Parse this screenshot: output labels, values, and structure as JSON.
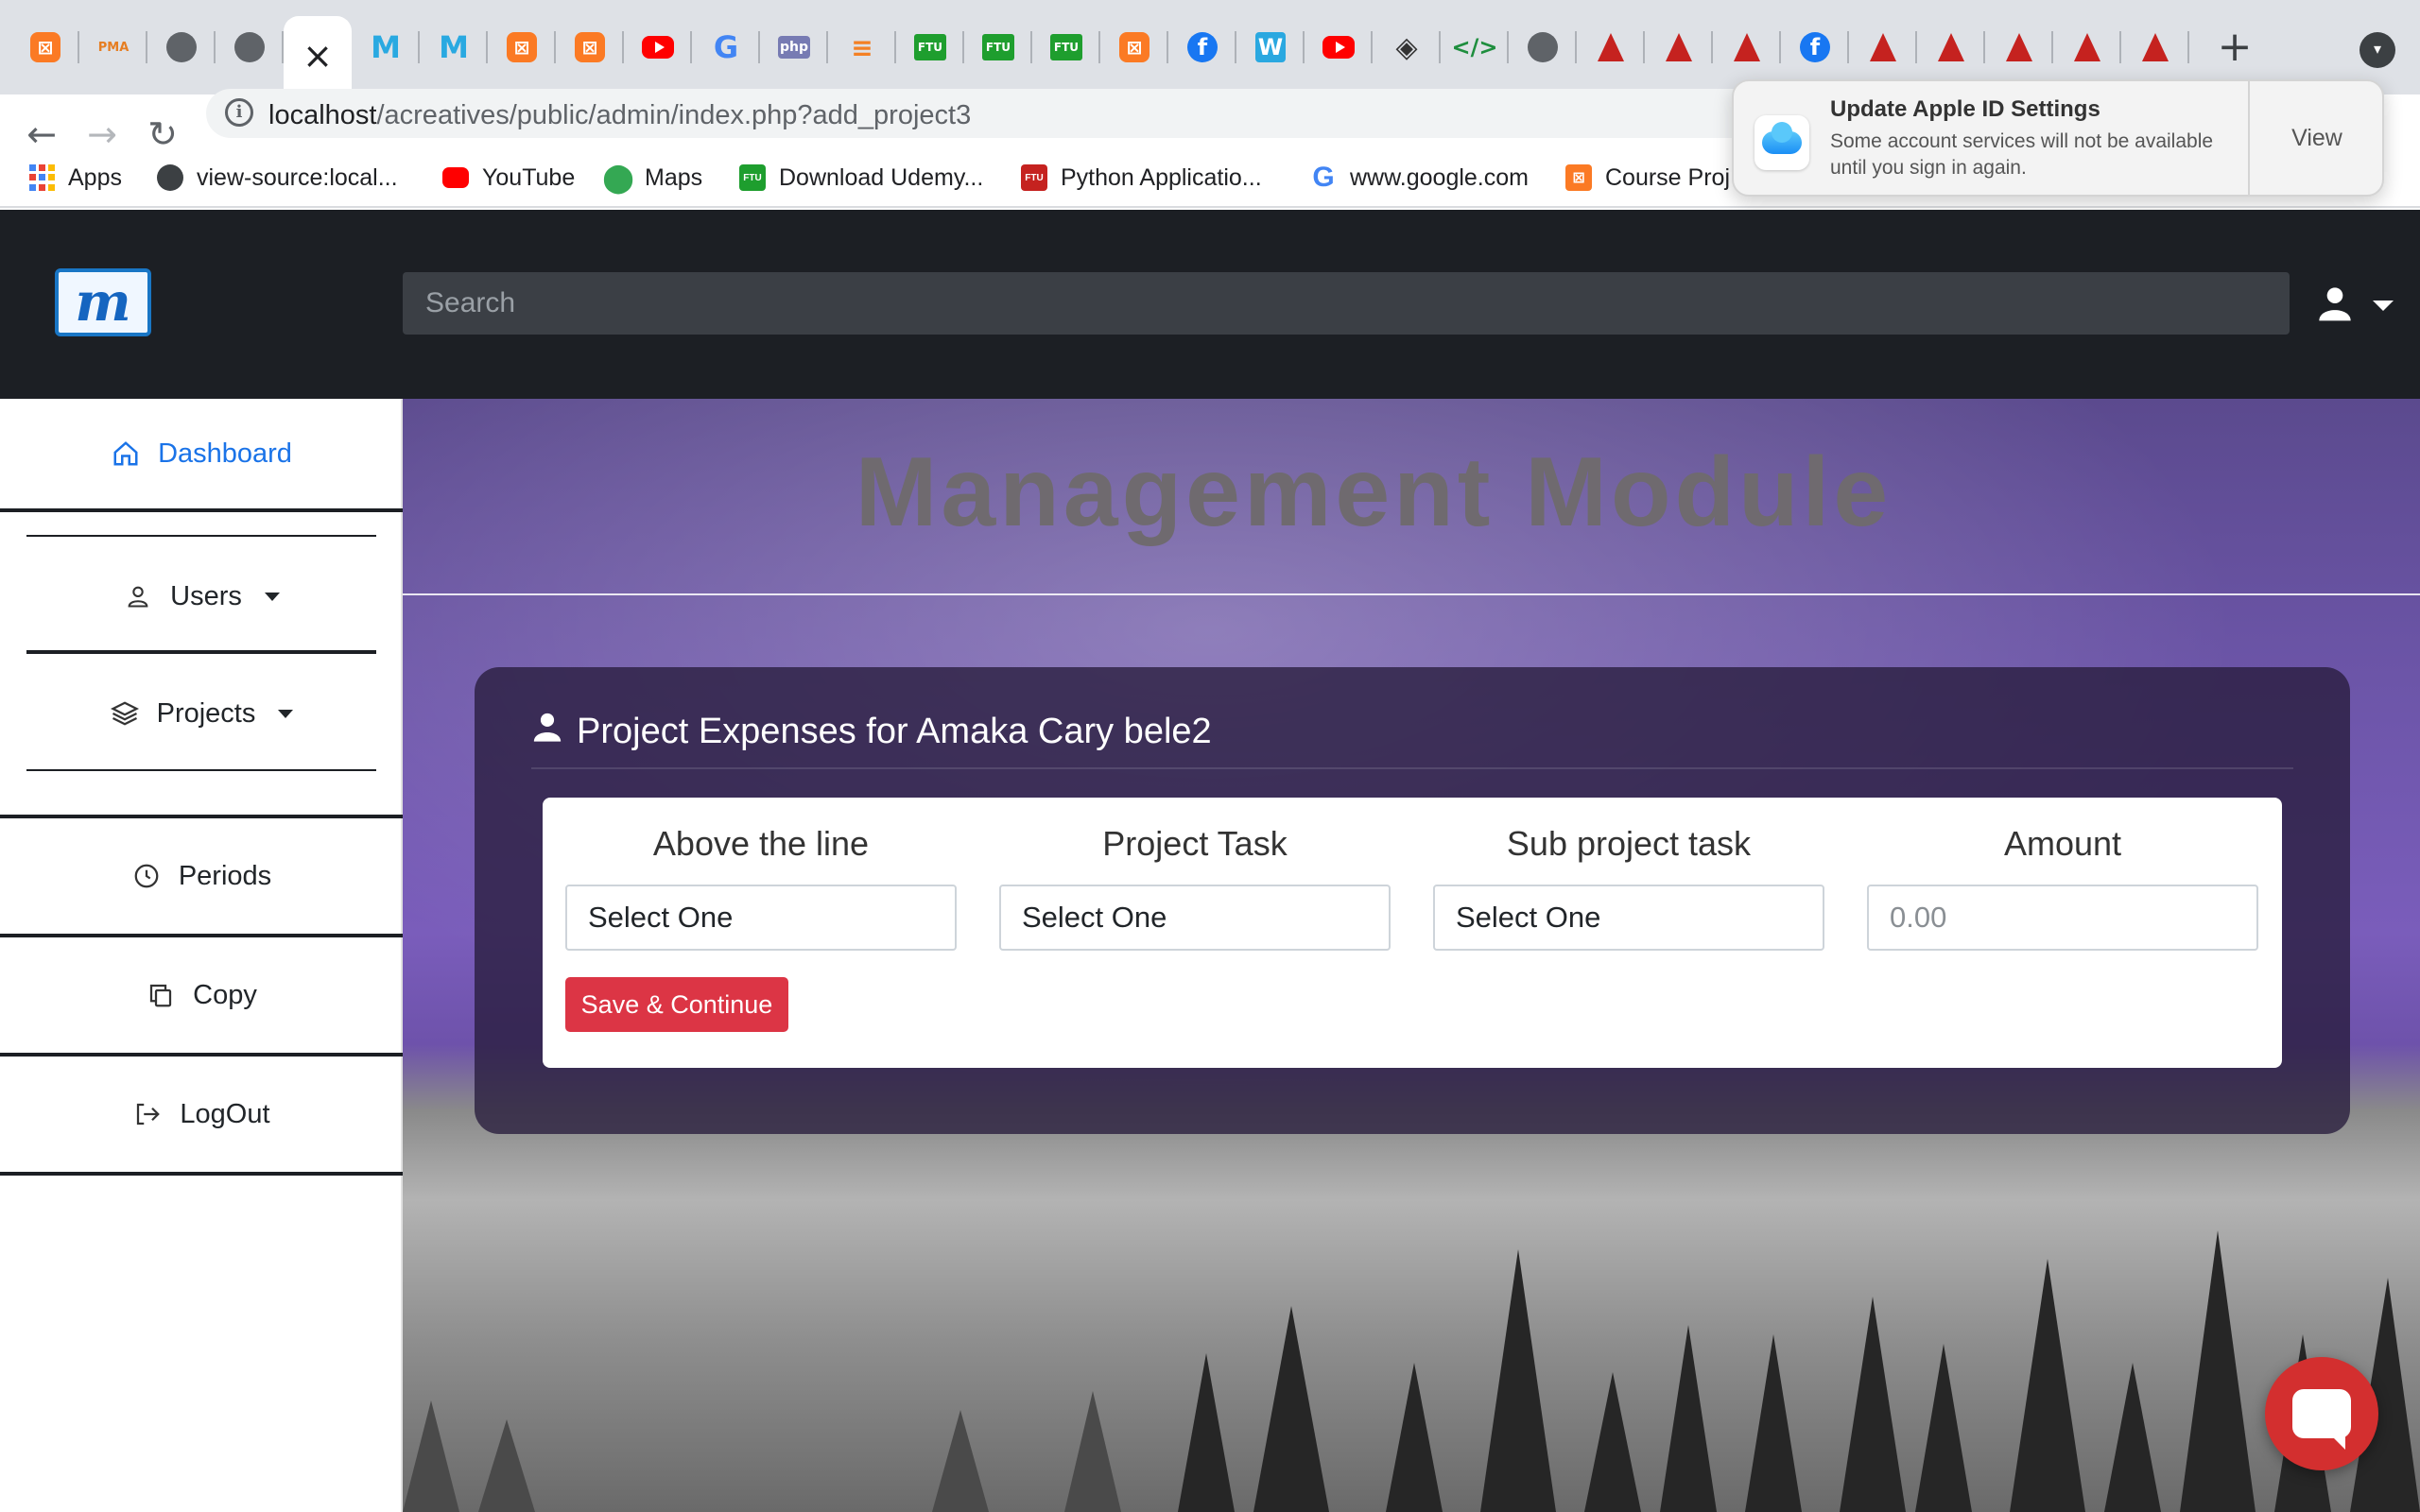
{
  "browser": {
    "tabs": [
      {
        "icon": "xampp-icon",
        "glyph": "⊠",
        "cls": "xampp"
      },
      {
        "icon": "phpmyadmin-icon",
        "glyph": "PMA",
        "cls": "pma"
      },
      {
        "icon": "globe-icon",
        "glyph": "",
        "cls": "globe"
      },
      {
        "icon": "globe-icon",
        "glyph": "",
        "cls": "globe"
      },
      {
        "icon": "close-icon",
        "glyph": "",
        "cls": "active"
      },
      {
        "icon": "m-icon",
        "glyph": "M",
        "cls": "m"
      },
      {
        "icon": "m-icon",
        "glyph": "M",
        "cls": "m"
      },
      {
        "icon": "xampp-icon",
        "glyph": "⊠",
        "cls": "xampp"
      },
      {
        "icon": "xampp-icon",
        "glyph": "⊠",
        "cls": "xampp"
      },
      {
        "icon": "youtube-icon",
        "glyph": "",
        "cls": "yt"
      },
      {
        "icon": "google-icon",
        "glyph": "G",
        "cls": "g"
      },
      {
        "icon": "php-icon",
        "glyph": "php",
        "cls": "php"
      },
      {
        "icon": "stackoverflow-icon",
        "glyph": "≡",
        "cls": "so"
      },
      {
        "icon": "ftu-icon",
        "glyph": "FTU",
        "cls": "ftu"
      },
      {
        "icon": "ftu-icon",
        "glyph": "FTU",
        "cls": "ftu"
      },
      {
        "icon": "ftu-icon",
        "glyph": "FTU",
        "cls": "ftu"
      },
      {
        "icon": "xampp-icon",
        "glyph": "⊠",
        "cls": "xampp"
      },
      {
        "icon": "facebook-icon",
        "glyph": "f",
        "cls": "fb"
      },
      {
        "icon": "w-icon",
        "glyph": "W",
        "cls": "w"
      },
      {
        "icon": "youtube-icon",
        "glyph": "",
        "cls": "yt"
      },
      {
        "icon": "diamond-icon",
        "glyph": "◈",
        "cls": "dia"
      },
      {
        "icon": "code-icon",
        "glyph": "</>",
        "cls": "code"
      },
      {
        "icon": "globe-icon",
        "glyph": "",
        "cls": "globe"
      },
      {
        "icon": "angular-icon",
        "glyph": "",
        "cls": "tri"
      },
      {
        "icon": "angular-icon",
        "glyph": "",
        "cls": "tri"
      },
      {
        "icon": "angular-icon",
        "glyph": "",
        "cls": "tri"
      },
      {
        "icon": "facebook-icon",
        "glyph": "f",
        "cls": "fb"
      },
      {
        "icon": "angular-icon",
        "glyph": "",
        "cls": "tri"
      },
      {
        "icon": "angular-icon",
        "glyph": "",
        "cls": "tri"
      },
      {
        "icon": "angular-icon",
        "glyph": "",
        "cls": "tri"
      },
      {
        "icon": "angular-icon",
        "glyph": "",
        "cls": "tri"
      },
      {
        "icon": "angular-icon",
        "glyph": "",
        "cls": "tri"
      }
    ],
    "url_host": "localhost",
    "url_path": "/acreatives/public/admin/index.php?add_project3",
    "bookmarks": [
      {
        "label": "Apps",
        "icon": "apps-grid-icon",
        "cls": "grid"
      },
      {
        "label": "view-source:local...",
        "icon": "globe-icon",
        "cls": "globe"
      },
      {
        "label": "YouTube",
        "icon": "youtube-icon",
        "cls": "yt"
      },
      {
        "label": "Maps",
        "icon": "maps-pin-icon",
        "cls": "maps"
      },
      {
        "label": "Download Udemy...",
        "icon": "ftu-icon",
        "cls": "ftu"
      },
      {
        "label": "Python Applicatio...",
        "icon": "ftu-icon",
        "cls": "ftured"
      },
      {
        "label": "www.google.com",
        "icon": "google-icon",
        "cls": "g"
      },
      {
        "label": "Course Proj",
        "icon": "xampp-icon",
        "cls": "xampp"
      }
    ]
  },
  "notification": {
    "title": "Update Apple ID Settings",
    "message": "Some account services will not be available until you sign in again.",
    "action": "View"
  },
  "app": {
    "search_placeholder": "Search",
    "sidebar": {
      "dashboard": "Dashboard",
      "users": "Users",
      "projects": "Projects",
      "periods": "Periods",
      "copy": "Copy",
      "logout": "LogOut"
    },
    "module_title": "Management Module",
    "card_title": "Project Expenses for Amaka Cary bele2",
    "form": {
      "above_line_label": "Above the line",
      "above_line_value": "Select One",
      "project_task_label": "Project Task",
      "project_task_value": "Select One",
      "sub_task_label": "Sub project task",
      "sub_task_value": "Select One",
      "amount_label": "Amount",
      "amount_placeholder": "0.00",
      "save_label": "Save & Continue"
    }
  }
}
